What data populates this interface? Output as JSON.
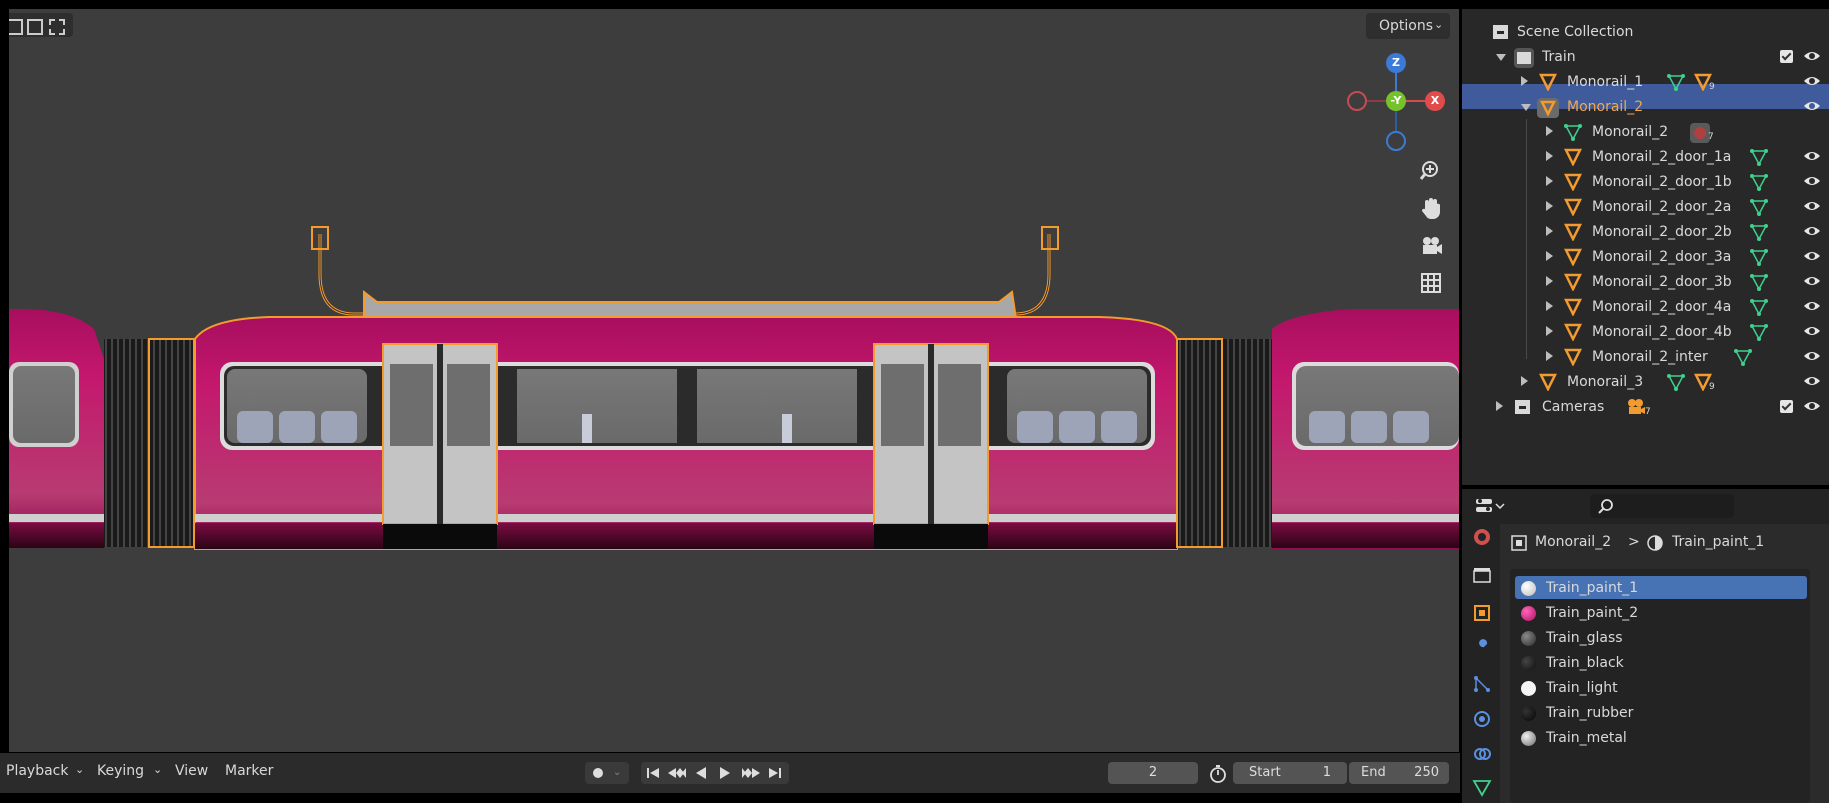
{
  "viewport": {
    "options_label": "Options",
    "gizmo": {
      "z": "Z",
      "y": "-Y",
      "x": "X"
    }
  },
  "outliner": {
    "rows": [
      {
        "label": "Scene Collection",
        "icon": "collection-icon"
      },
      {
        "label": "Train",
        "icon": "collection-icon"
      },
      {
        "label": "Monorail_1",
        "icon": "mesh-object-icon",
        "badge": "9"
      },
      {
        "label": "Monorail_2",
        "icon": "mesh-object-icon"
      },
      {
        "label": "Monorail_2",
        "icon": "mesh-data-icon",
        "badge": "7"
      },
      {
        "label": "Monorail_2_door_1a",
        "icon": "mesh-object-icon"
      },
      {
        "label": "Monorail_2_door_1b",
        "icon": "mesh-object-icon"
      },
      {
        "label": "Monorail_2_door_2a",
        "icon": "mesh-object-icon"
      },
      {
        "label": "Monorail_2_door_2b",
        "icon": "mesh-object-icon"
      },
      {
        "label": "Monorail_2_door_3a",
        "icon": "mesh-object-icon"
      },
      {
        "label": "Monorail_2_door_3b",
        "icon": "mesh-object-icon"
      },
      {
        "label": "Monorail_2_door_4a",
        "icon": "mesh-object-icon"
      },
      {
        "label": "Monorail_2_door_4b",
        "icon": "mesh-object-icon"
      },
      {
        "label": "Monorail_2_inter",
        "icon": "mesh-object-icon"
      },
      {
        "label": "Monorail_3",
        "icon": "mesh-object-icon",
        "badge": "9"
      },
      {
        "label": "Cameras",
        "icon": "collection-icon",
        "badge": "7"
      }
    ]
  },
  "properties": {
    "breadcrumb": {
      "object": "Monorail_2",
      "separator": ">",
      "material": "Train_paint_1"
    },
    "materials": [
      {
        "label": "Train_paint_1",
        "color": "#e8e8e8"
      },
      {
        "label": "Train_paint_2",
        "color": "#d0147a"
      },
      {
        "label": "Train_glass",
        "color": "#555555"
      },
      {
        "label": "Train_black",
        "color": "#1a1a1a"
      },
      {
        "label": "Train_light",
        "color": "#f5f5f5"
      },
      {
        "label": "Train_rubber",
        "color": "#0e0e0e"
      },
      {
        "label": "Train_metal",
        "color": "#bfbfbf"
      }
    ]
  },
  "timeline": {
    "playback": "Playback",
    "keying": "Keying",
    "view": "View",
    "marker": "Marker",
    "current_frame": "2",
    "start_label": "Start",
    "start_value": "1",
    "end_label": "End",
    "end_value": "250"
  },
  "colors": {
    "selection": "#3f5b9c",
    "material_selected": "#4772b3",
    "outline": "#f39b2f",
    "train_body": "#c4186d"
  }
}
